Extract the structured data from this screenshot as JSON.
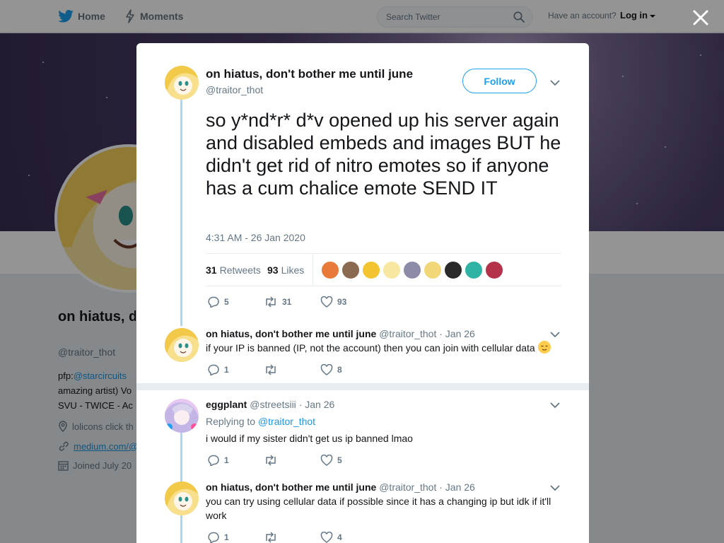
{
  "nav": {
    "home_label": "Home",
    "moments_label": "Moments",
    "search_placeholder": "Search Twitter",
    "account_prompt": "Have an account?",
    "login_label": "Log in"
  },
  "profile": {
    "name": "on hiatus, don't bother me until june",
    "handle": "@traitor_thot",
    "bio_prefix": "pfp:",
    "bio_link": "@starcircuits",
    "bio_line2": "amazing artist) Vo",
    "bio_line3": "SVU - TWICE - Ac",
    "location": "lolicons click th",
    "url": "medium.com/@",
    "joined": "Joined July 20"
  },
  "colors": {
    "accent": "#1da1f2",
    "thread_line": "#a9d7f6",
    "link": "#1b95e0"
  },
  "tweet": {
    "author_name": "on hiatus, don't bother me until june",
    "author_handle": "@traitor_thot",
    "follow_label": "Follow",
    "text": "so y*nd*r* d*v opened up his server again and disabled embeds and images BUT he didn't get rid of nitro emotes so if anyone has a cum chalice emote SEND IT",
    "timestamp": "4:31 AM - 26 Jan 2020",
    "retweets_count": "31",
    "retweets_label": "Retweets",
    "likes_count": "93",
    "likes_label": "Likes",
    "replies": "5",
    "retweets": "31",
    "likes": "93"
  },
  "replies": [
    {
      "name": "on hiatus, don't bother me until june",
      "handle": "@traitor_thot",
      "date": "· Jan 26",
      "text": "if your IP is banned (IP, not the account) then you can join with cellular data",
      "emoji": "relieved-face-emoji",
      "replies": "1",
      "retweets": "",
      "likes": "8"
    },
    {
      "name": "eggplant",
      "handle": "@streetsiii",
      "date": "· Jan 26",
      "replying_prefix": "Replying to",
      "replying_to": "@traitor_thot",
      "text": "i would if my sister didn't get us ip banned lmao",
      "replies": "1",
      "retweets": "",
      "likes": "5"
    },
    {
      "name": "on hiatus, don't bother me until june",
      "handle": "@traitor_thot",
      "date": "· Jan 26",
      "text": "you can try using cellular data if possible since it has a changing ip but idk if it'll work",
      "replies": "1",
      "retweets": "",
      "likes": "4"
    }
  ]
}
